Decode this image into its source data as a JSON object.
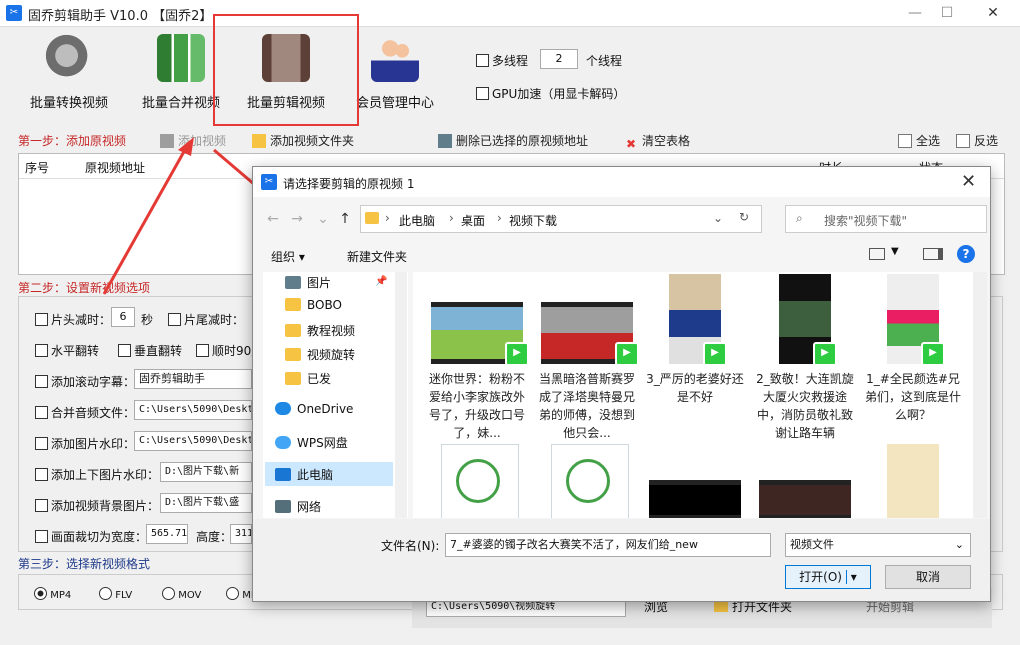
{
  "window": {
    "title": "固乔剪辑助手 V10.0  【固乔2】"
  },
  "toolbar": {
    "items": [
      {
        "label": "批量转换视频"
      },
      {
        "label": "批量合并视频"
      },
      {
        "label": "批量剪辑视频"
      },
      {
        "label": "会员管理中心"
      }
    ],
    "multithread_label": "多线程",
    "thread_count": "2",
    "thread_suffix": "个线程",
    "gpu_label": "GPU加速（用显卡解码）"
  },
  "step1": {
    "label": "第一步：添加原视频",
    "add_video": "添加视频",
    "add_folder": "添加视频文件夹",
    "delete_selected": "删除已选择的原视频地址",
    "clear_table": "清空表格",
    "select_all": "全选",
    "invert": "反选",
    "columns": [
      "序号",
      "原视频地址",
      "时长",
      "状态"
    ]
  },
  "step2": {
    "label": "第二步：设置新视频选项",
    "head_cut": "片头减时：",
    "head_cut_value": "6",
    "sec_unit": "秒",
    "tail_cut": "片尾减时：",
    "hflip": "水平翻转",
    "vflip": "垂直翻转",
    "rotate": "顺时90度",
    "subtitle": "添加滚动字幕：",
    "subtitle_value": "固乔剪辑助手",
    "merge_audio": "合并音频文件：",
    "merge_audio_value": "C:\\Users\\5090\\Deskt",
    "image_watermark": "添加图片水印：",
    "image_watermark_value": "C:\\Users\\5090\\Deskt",
    "top_bottom": "添加上下图片水印：",
    "top_bottom_value": "D:\\图片下载\\新",
    "bg_image": "添加视频背景图片：",
    "bg_image_value": "D:\\图片下载\\盛",
    "crop_width": "画面裁切为宽度：",
    "crop_width_value": "565.714",
    "height_label": "高度：",
    "height_value": "311"
  },
  "step3": {
    "label": "第三步：选择新视频格式",
    "formats": [
      "MP4",
      "FLV",
      "MOV",
      "MK"
    ],
    "output_path": "C:\\Users\\5090\\视频旋转",
    "browse": "浏览",
    "open_folder": "打开文件夹",
    "start": "开始剪辑"
  },
  "dialog": {
    "title": "请选择要剪辑的原视频 1",
    "breadcrumb": [
      "此电脑",
      "桌面",
      "视频下载"
    ],
    "search_placeholder": "搜索\"视频下载\"",
    "organize": "组织",
    "new_folder": "新建文件夹",
    "nav": [
      "图片",
      "BOBO",
      "教程视频",
      "视频旋转",
      "已发",
      "OneDrive",
      "WPS网盘",
      "此电脑",
      "网络"
    ],
    "files": [
      {
        "name": "迷你世界：粉粉不爱给小李家族改外号了，升级改口号了，妹..."
      },
      {
        "name": "当黑暗洛普斯赛罗成了泽塔奥特曼兄弟的师傅，没想到他只会..."
      },
      {
        "name": "3_严厉的老婆好还是不好"
      },
      {
        "name": "2_致敬！大连凯旋大厦火灾救援途中，消防员敬礼致谢让路车辆"
      },
      {
        "name": "1_#全民颜选#兄弟们，这到底是什么啊？"
      }
    ],
    "filename_label": "文件名(N):",
    "filename_value": "7_#婆婆的镯子改名大赛笑不活了，网友们给_new",
    "filetype": "视频文件",
    "open": "打开(O)",
    "cancel": "取消"
  },
  "colors": {
    "step_red": "#c62828",
    "step_blue": "#1e3a8a",
    "highlight": "#e53935",
    "wechat_green": "#2ecc40"
  }
}
